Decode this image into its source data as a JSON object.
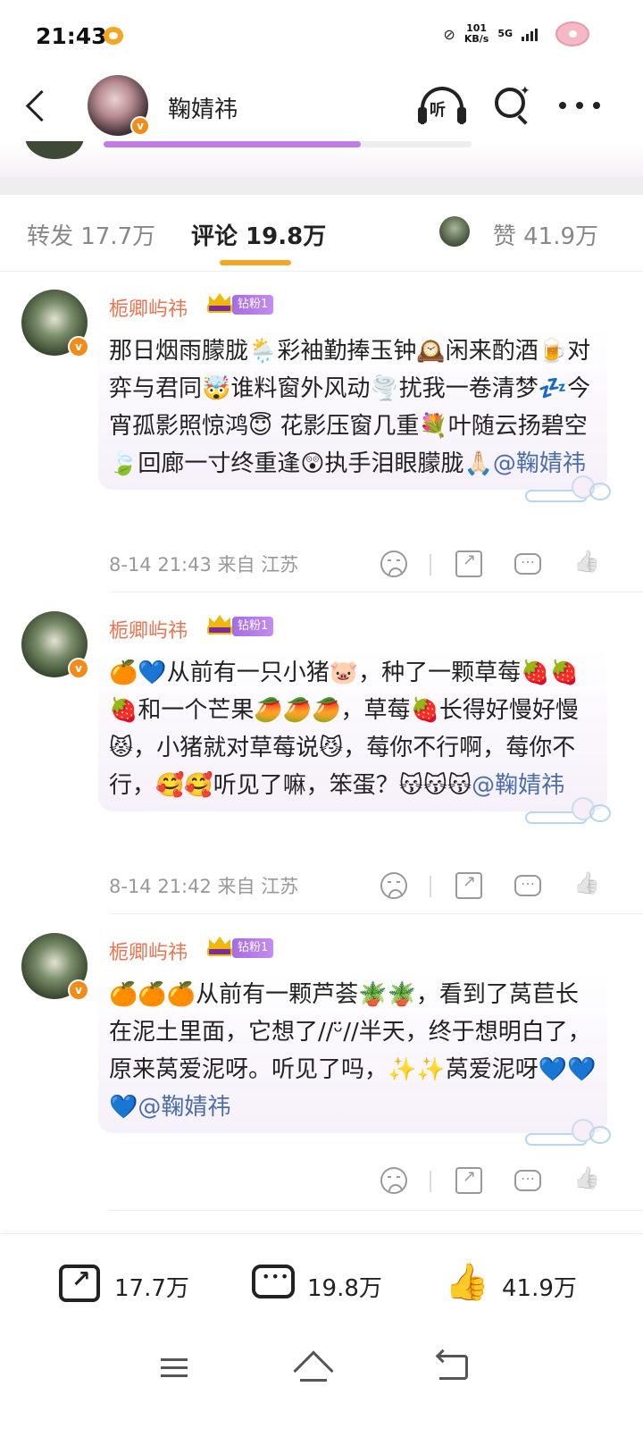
{
  "status_bar": {
    "time": "21:43",
    "net_speed_value": "101",
    "net_speed_unit": "KB/s",
    "network": "5G"
  },
  "header": {
    "username": "鞠婧祎",
    "listen_label": "听"
  },
  "tabs": {
    "forward": "转发 17.7万",
    "comments": "评论 19.8万",
    "likes": "赞 41.9万"
  },
  "comments": [
    {
      "author": "栀卿屿祎",
      "badge": "钻粉1",
      "text": "那日烟雨朦胧🌦️彩袖勤捧玉钟🕰️闲来酌酒🍺对弈与君同🤯谁料窗外风动🌪️扰我一卷清梦💤今宵孤影照惊鸿😇 花影压窗几重💐叶随云扬碧空🍃回廊一寸终重逢😲执手泪眼朦胧🙏🏻",
      "mention": "@鞠婧祎",
      "time": "8-14 21:43",
      "location": "来自 江苏"
    },
    {
      "author": "栀卿屿祎",
      "badge": "钻粉1",
      "text": "🍊💙从前有一只小猪🐷，种了一颗草莓🍓🍓🍓和一个芒果🥭🥭🥭，草莓🍓长得好慢好慢😾，小猪就对草莓说😼，莓你不行啊，莓你不行，🥰🥰听见了嘛，笨蛋？😽😽😽",
      "mention": "@鞠婧祎",
      "time": "8-14 21:42",
      "location": "来自 江苏"
    },
    {
      "author": "栀卿屿祎",
      "badge": "钻粉1",
      "text": "🍊🍊🍊从前有一颗芦荟🪴🪴，看到了莴苣长在泥土里面，它想了//ᵕ̈//半天，终于想明白了，原来莴爱泥呀。听见了吗，✨✨莴爱泥呀💙💙💙",
      "mention": "@鞠婧祎",
      "time": "",
      "location": ""
    }
  ],
  "bottom_bar": {
    "share_count": "17.7万",
    "comment_count": "19.8万",
    "like_count": "41.9万"
  },
  "colors": {
    "accent_orange": "#f5a623",
    "author_name": "#eb7350",
    "mention_blue": "#4a6fa8",
    "fan_badge": "#b37ee6",
    "progress_purple": "#c07de8"
  },
  "post_strip": {
    "progress_fraction": 0.7
  }
}
